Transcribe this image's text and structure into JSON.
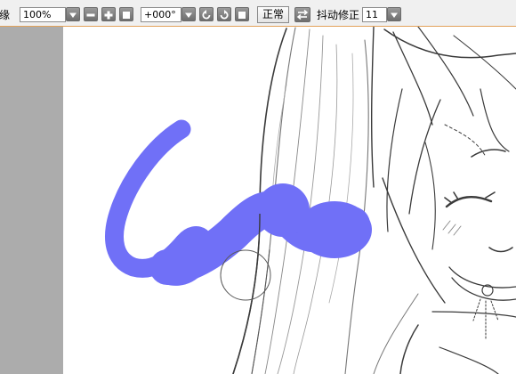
{
  "toolbar": {
    "partial_label": "缘",
    "opacity_value": "100%",
    "angle_value": "+000°",
    "blend_mode_label": "正常",
    "stabilizer_label": "抖动修正",
    "stabilizer_value": "11"
  },
  "icons": {
    "dropdown": "triangle-down-icon",
    "minus": "minus-icon",
    "plus": "plus-icon",
    "reset": "square-icon",
    "rotate_ccw": "rotate-left-icon",
    "rotate_cw": "rotate-right-icon",
    "swap": "swap-icon"
  },
  "colors": {
    "stroke": "#7070f7",
    "toolbar_accent": "#e2a25a",
    "panel_gray": "#acacac"
  }
}
